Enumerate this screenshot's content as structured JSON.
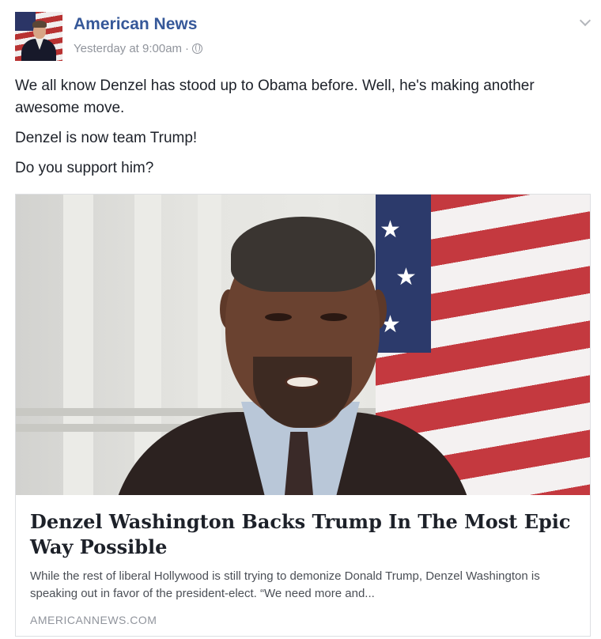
{
  "post": {
    "page_name": "American News",
    "timestamp": "Yesterday at 9:00am",
    "separator": "·",
    "privacy_icon": "globe-icon",
    "menu_icon": "chevron-down-icon",
    "text_paragraphs": [
      "We all know Denzel has stood up to Obama before. Well, he's making another awesome move.",
      "Denzel is now team Trump!",
      "Do you support him?"
    ]
  },
  "link_card": {
    "headline": "Denzel Washington Backs Trump In The Most Epic Way Possible",
    "description": "While the rest of liberal Hollywood is still trying to demonize Donald Trump, Denzel Washington is speaking out in favor of the president-elect. “We need more and...",
    "domain": "AMERICANNEWS.COM"
  },
  "colors": {
    "page_name": "#365899",
    "meta": "#90949c",
    "text": "#1d2129",
    "card_border": "#dddfe2"
  }
}
